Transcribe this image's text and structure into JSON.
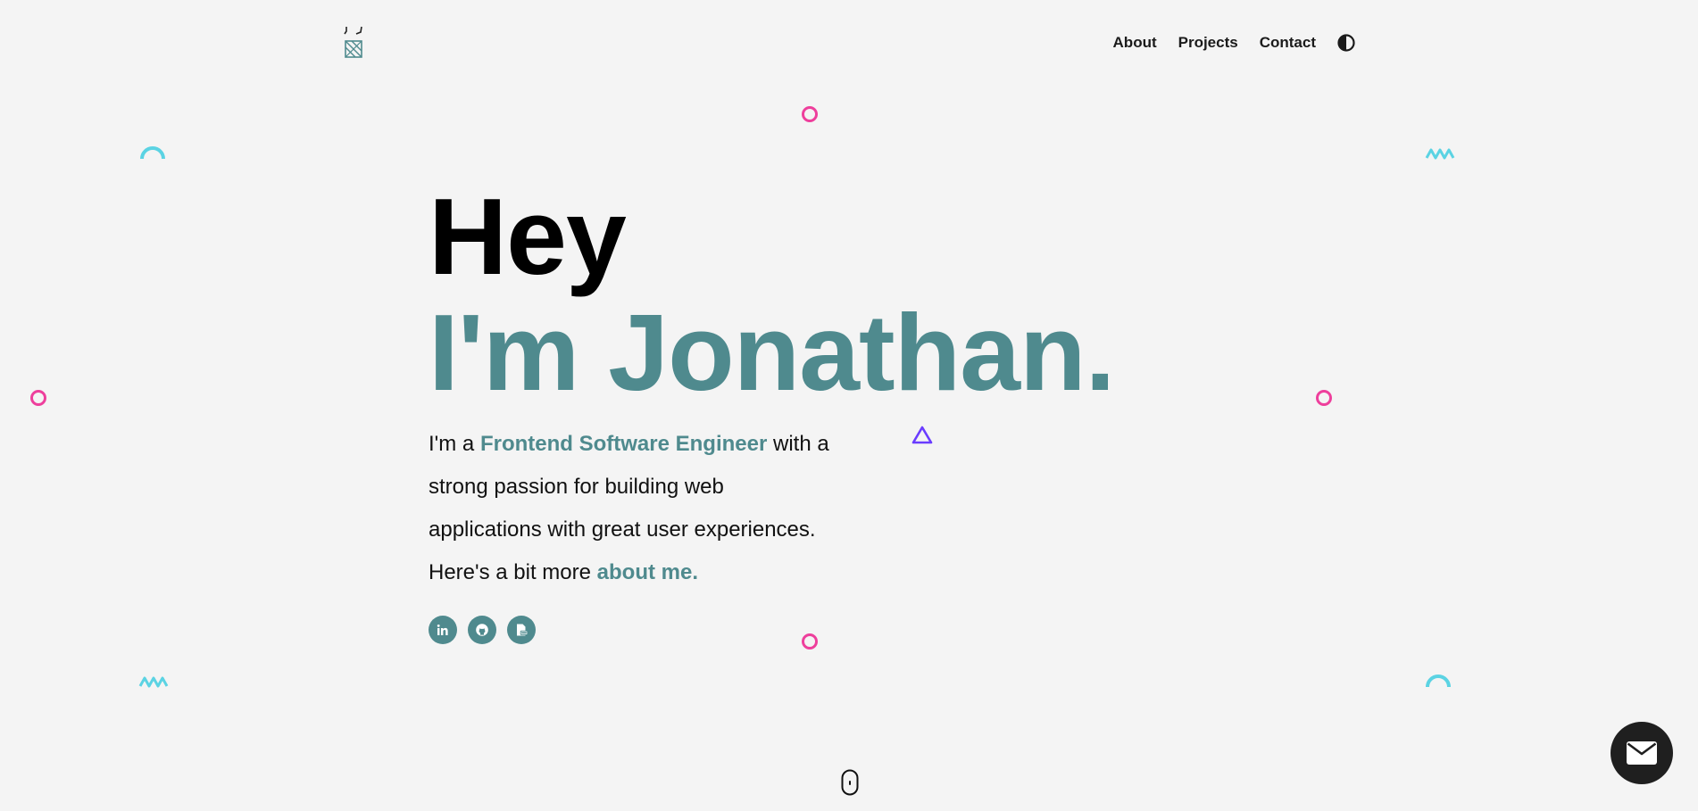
{
  "header": {
    "nav": [
      "About",
      "Projects",
      "Contact"
    ]
  },
  "hero": {
    "greeting": "Hey",
    "name_line": "I'm Jonathan.",
    "intro_prefix": "I'm a ",
    "intro_role": "Frontend Software Engineer",
    "intro_rest": " with a strong passion for building web applications with great user experiences.",
    "more_prefix": "Here's a bit more ",
    "more_link": "about me."
  },
  "socials": [
    "linkedin-icon",
    "github-icon",
    "resume-icon"
  ],
  "colors": {
    "accent": "#4f8a8e",
    "pink": "#ee3f9c",
    "cyan": "#5bd3e3",
    "purple": "#6a3cff",
    "dark": "#1f1f1f",
    "background": "#f4f4f4"
  }
}
